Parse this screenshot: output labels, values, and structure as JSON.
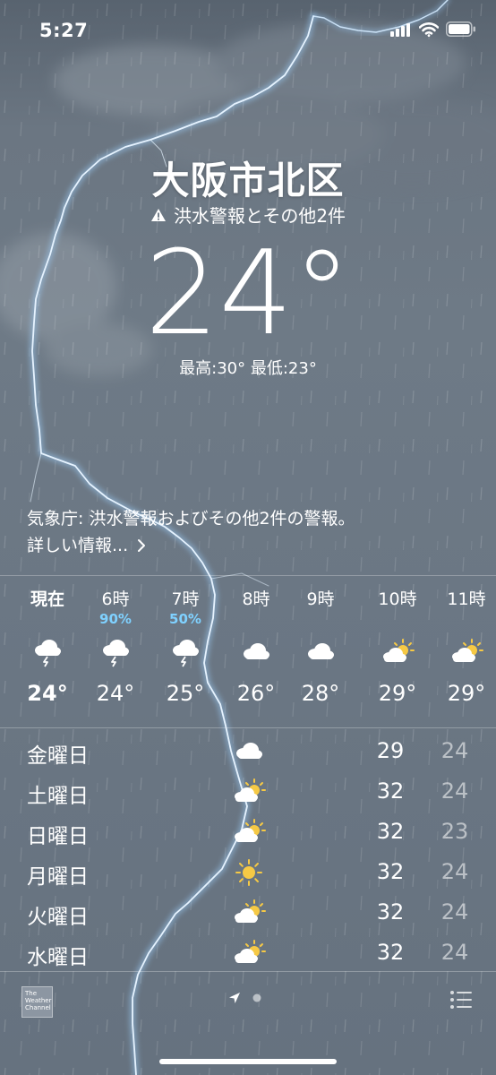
{
  "status_bar": {
    "time": "5:27"
  },
  "location": {
    "city": "大阪市北区",
    "alert_text": "洪水警報とその他2件"
  },
  "current": {
    "temperature": "24°",
    "hi_lo": "最高:30° 最低:23°"
  },
  "notice": {
    "text": "気象庁: 洪水警報およびその他2件の警報。",
    "link": "詳しい情報..."
  },
  "hourly": [
    {
      "time": "現在",
      "pop": "",
      "icon": "thunderstorm-rain-icon",
      "temp": "24°"
    },
    {
      "time": "6時",
      "pop": "90%",
      "icon": "thunderstorm-rain-icon",
      "temp": "24°"
    },
    {
      "time": "7時",
      "pop": "50%",
      "icon": "thunderstorm-rain-icon",
      "temp": "25°"
    },
    {
      "time": "8時",
      "pop": "",
      "icon": "cloud-icon",
      "temp": "26°"
    },
    {
      "time": "9時",
      "pop": "",
      "icon": "cloud-icon",
      "temp": "28°"
    },
    {
      "time": "10時",
      "pop": "",
      "icon": "partly-sunny-icon",
      "temp": "29°"
    },
    {
      "time": "11時",
      "pop": "",
      "icon": "partly-sunny-icon",
      "temp": "29°"
    }
  ],
  "daily": [
    {
      "day": "金曜日",
      "icon": "cloud-icon",
      "high": "29",
      "low": "24"
    },
    {
      "day": "土曜日",
      "icon": "partly-sunny-icon",
      "high": "32",
      "low": "24"
    },
    {
      "day": "日曜日",
      "icon": "partly-sunny-icon",
      "high": "32",
      "low": "23"
    },
    {
      "day": "月曜日",
      "icon": "sun-icon",
      "high": "32",
      "low": "24"
    },
    {
      "day": "火曜日",
      "icon": "partly-sunny-icon",
      "high": "32",
      "low": "24"
    },
    {
      "day": "水曜日",
      "icon": "partly-sunny-icon",
      "high": "32",
      "low": "24"
    }
  ],
  "footer": {
    "logo_text": "The Weather Channel"
  },
  "colors": {
    "accent_pop": "#7fd1ff",
    "sun": "#f6c945",
    "lightning": "#cfe8ff"
  }
}
